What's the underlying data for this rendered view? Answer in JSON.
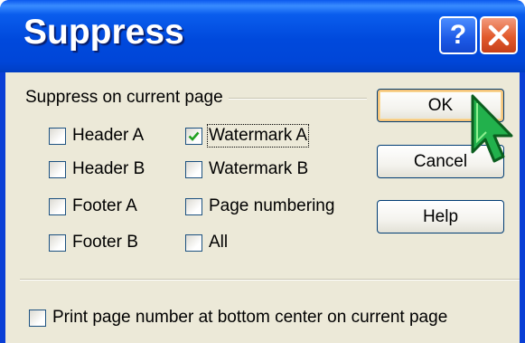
{
  "window": {
    "title": "Suppress",
    "help_glyph": "?",
    "close_icon": "close-x-icon"
  },
  "group": {
    "label": "Suppress on current page"
  },
  "checkboxes": [
    {
      "label": "Header A",
      "checked": false
    },
    {
      "label": "Header B",
      "checked": false
    },
    {
      "label": "Footer A",
      "checked": false
    },
    {
      "label": "Footer B",
      "checked": false
    },
    {
      "label": "Watermark A",
      "checked": true
    },
    {
      "label": "Watermark B",
      "checked": false
    },
    {
      "label": "Page numbering",
      "checked": false
    },
    {
      "label": "All",
      "checked": false
    }
  ],
  "bottom_checkbox": {
    "label": "Print page number at bottom center on current page",
    "checked": false
  },
  "buttons": {
    "ok": "OK",
    "cancel": "Cancel",
    "help": "Help"
  },
  "colors": {
    "titlebar": "#0049dc",
    "client": "#ece9d8",
    "check": "#21a121",
    "cursor": "#22b14c"
  }
}
